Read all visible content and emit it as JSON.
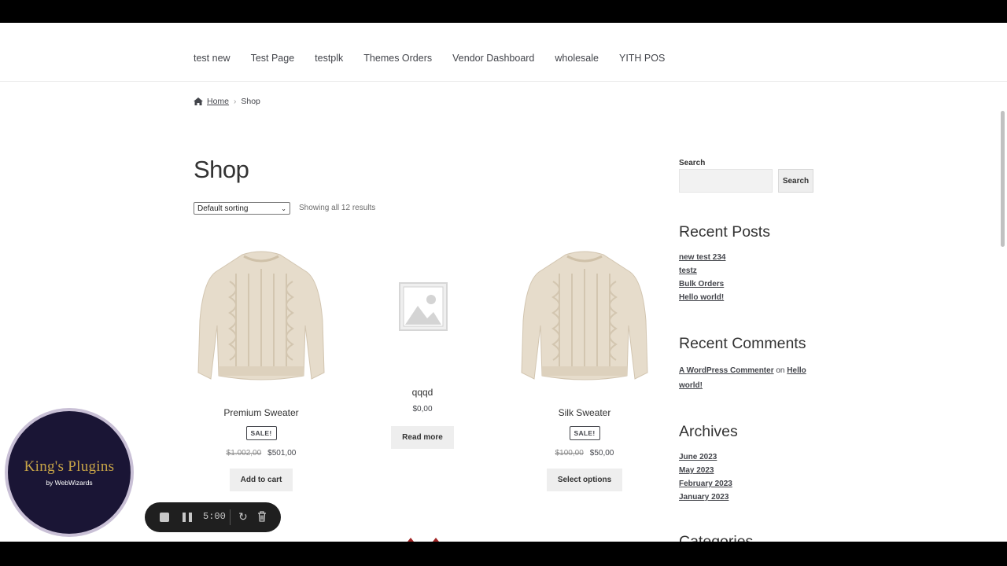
{
  "nav": {
    "items": [
      "test new",
      "Test Page",
      "testplk",
      "Themes Orders",
      "Vendor Dashboard",
      "wholesale",
      "YITH POS"
    ]
  },
  "breadcrumb": {
    "home": "Home",
    "current": "Shop"
  },
  "page": {
    "title": "Shop",
    "sort_selected": "Default sorting",
    "results_text": "Showing all 12 results"
  },
  "products": [
    {
      "name": "Premium Sweater",
      "badge": "SALE!",
      "old_price": "$1.002,00",
      "price": "$501,00",
      "button": "Add to cart"
    },
    {
      "name": "qqqd",
      "price": "$0,00",
      "button": "Read more"
    },
    {
      "name": "Silk Sweater",
      "badge": "SALE!",
      "old_price": "$100,00",
      "price": "$50,00",
      "button": "Select options"
    }
  ],
  "sidebar": {
    "search_label": "Search",
    "search_button": "Search",
    "recent_posts_title": "Recent Posts",
    "recent_posts": [
      "new test 234",
      "testz",
      "Bulk Orders",
      "Hello world!"
    ],
    "recent_comments_title": "Recent Comments",
    "comment_author": "A WordPress Commenter",
    "comment_on": "on",
    "comment_post": "Hello world!",
    "archives_title": "Archives",
    "archives": [
      "June 2023",
      "May 2023",
      "February 2023",
      "January 2023"
    ],
    "categories_title": "Categories"
  },
  "overlay": {
    "logo_text": "King's Plugins",
    "logo_sub": "by WebWizards",
    "timer": "5:00"
  },
  "colors": {
    "accent": "#43454b",
    "button_bg": "#eeeeee",
    "logo_bg": "#1a1535",
    "logo_gold": "#c9a547"
  }
}
